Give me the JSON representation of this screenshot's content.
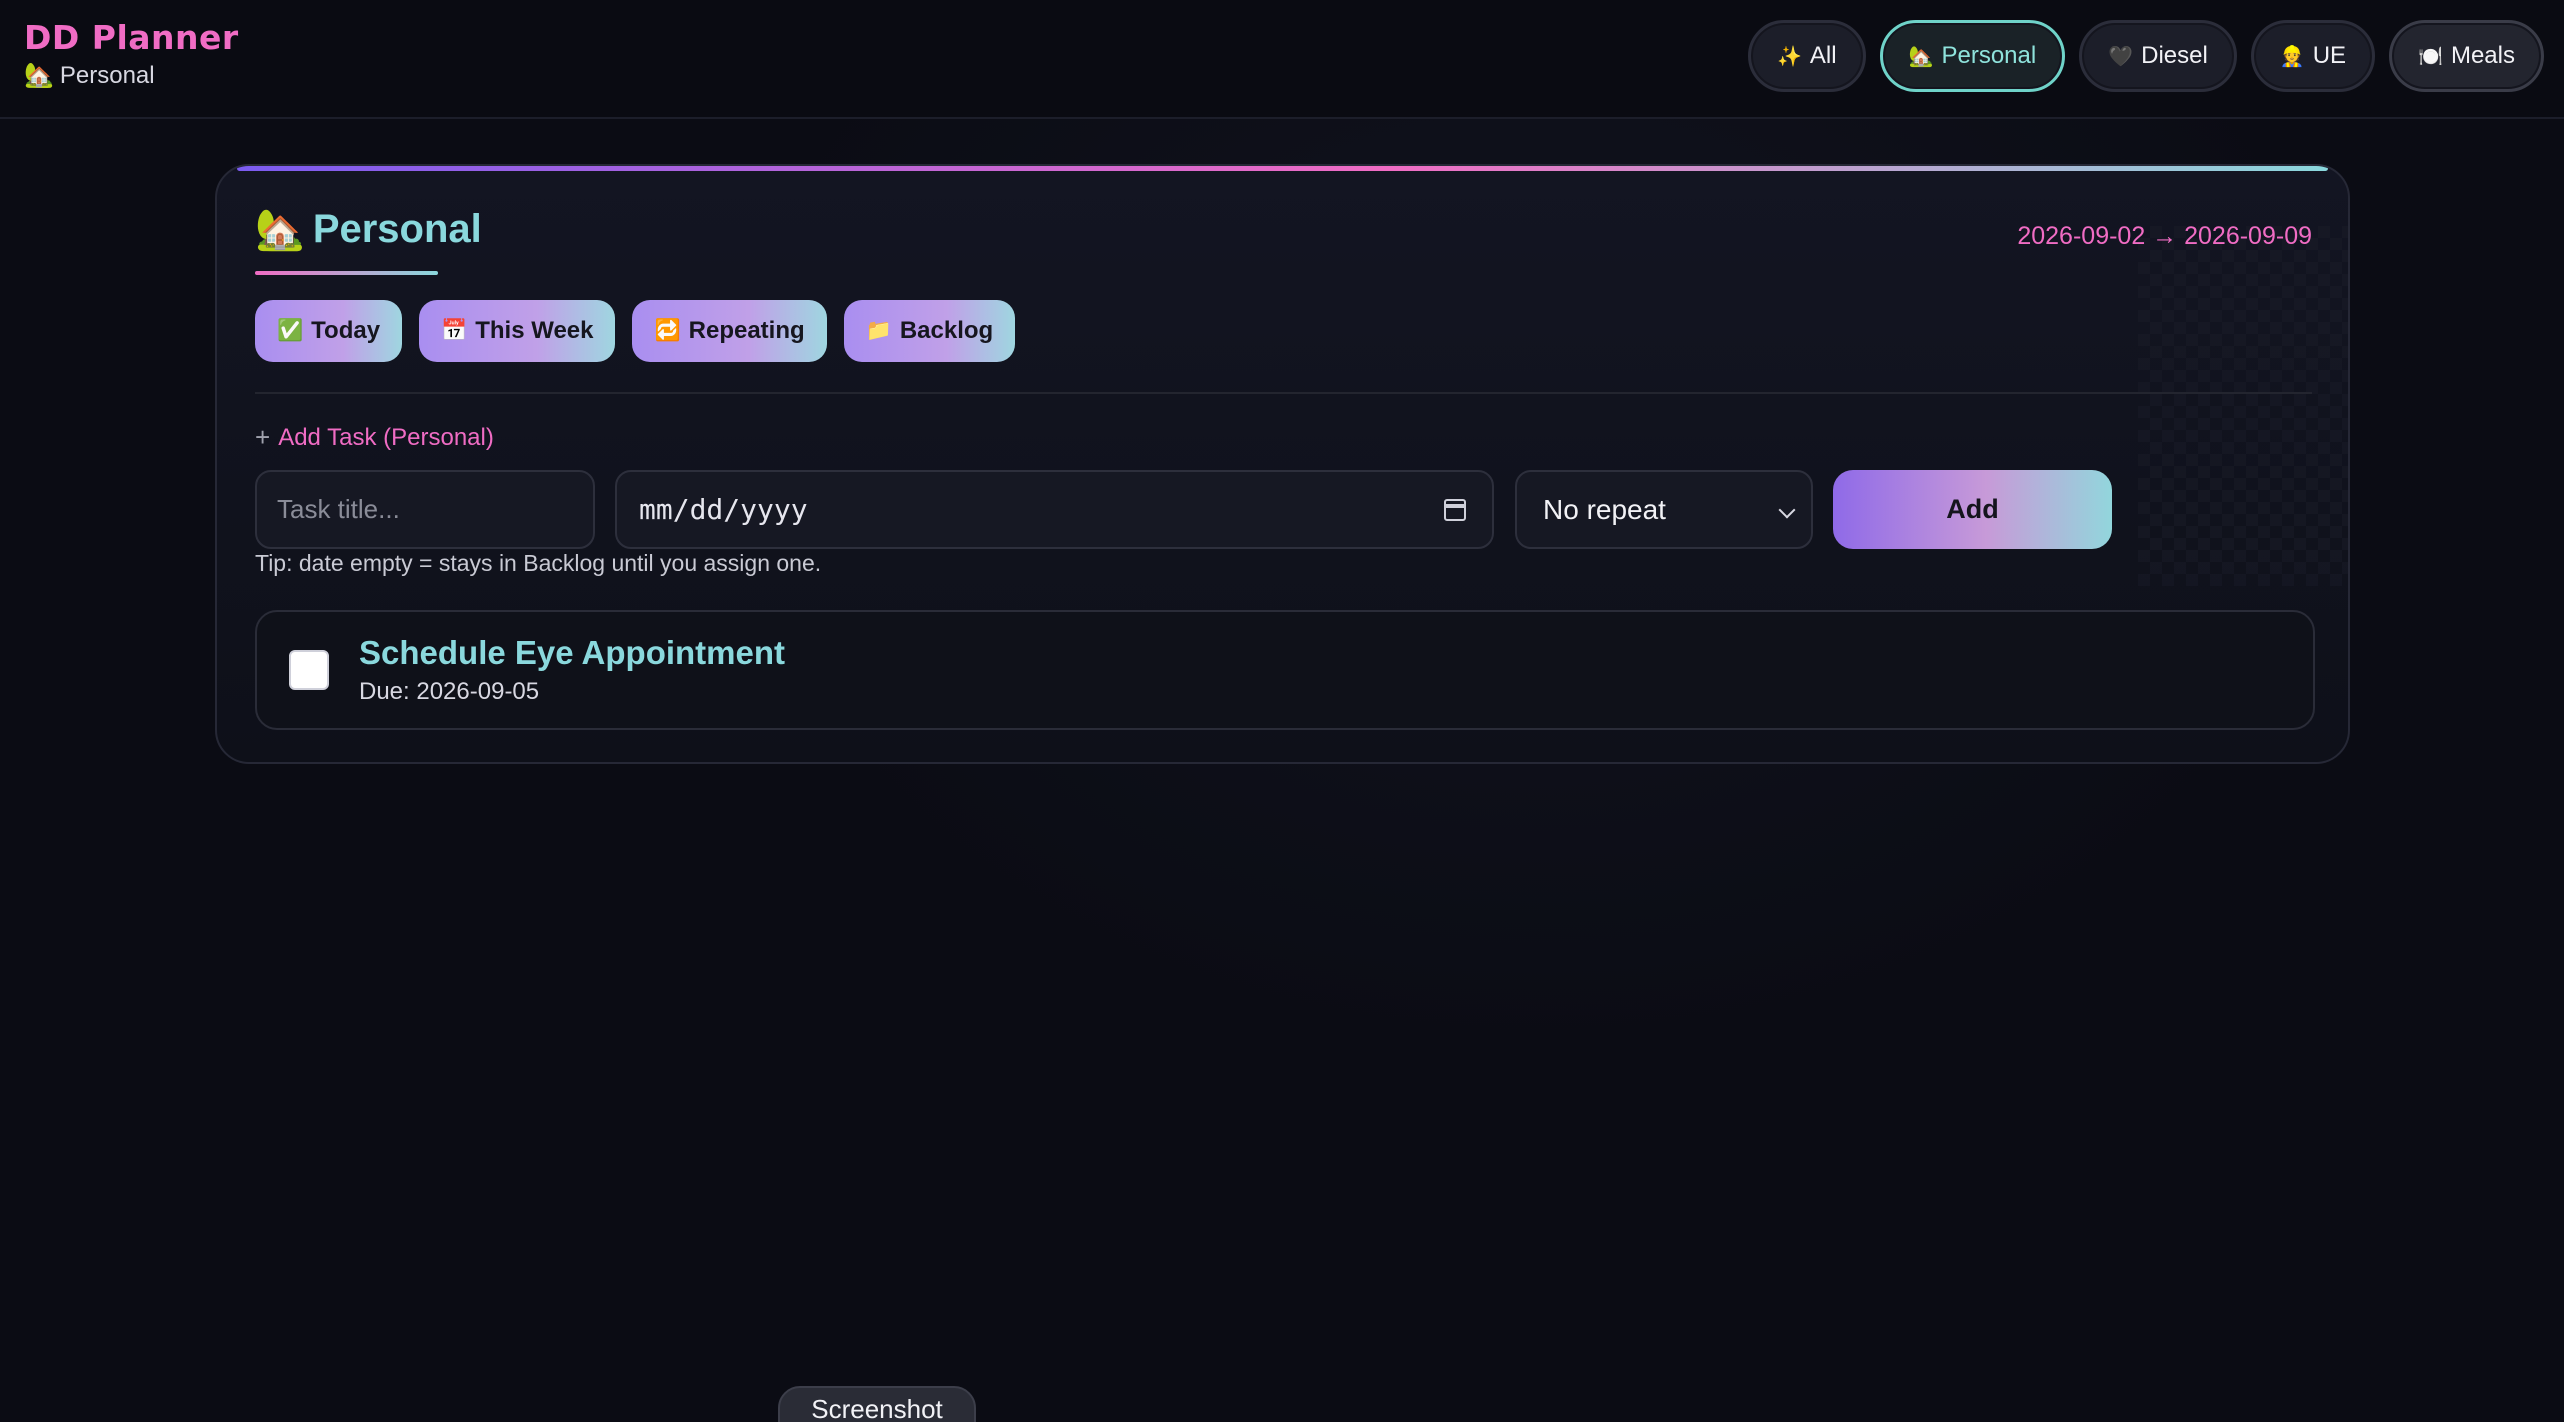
{
  "app": {
    "title": "DD Planner",
    "current_context": "Personal",
    "current_context_emoji": "🏡"
  },
  "nav": [
    {
      "emoji": "✨",
      "label": "All",
      "active": false
    },
    {
      "emoji": "🏡",
      "label": "Personal",
      "active": true
    },
    {
      "emoji": "🖤",
      "label": "Diesel",
      "active": false
    },
    {
      "emoji": "👷",
      "label": "UE",
      "active": false
    },
    {
      "emoji": "🍽️",
      "label": "Meals",
      "active": false
    }
  ],
  "card": {
    "title_emoji": "🏡",
    "title": "Personal",
    "date_range": "2026-09-02 → 2026-09-09",
    "tabs": [
      {
        "emoji": "✅",
        "label": "Today"
      },
      {
        "emoji": "📅",
        "label": "This Week"
      },
      {
        "emoji": "🔁",
        "label": "Repeating"
      },
      {
        "emoji": "📁",
        "label": "Backlog"
      }
    ],
    "add_task": {
      "label": "Add Task (Personal)",
      "plus": "+",
      "title_placeholder": "Task title...",
      "date_placeholder": "mm/dd/yyyy",
      "repeat_value": "No repeat",
      "button": "Add",
      "tip": "Tip: date empty = stays in Backlog until you assign one."
    },
    "tasks": [
      {
        "title": "Schedule Eye Appointment",
        "due": "Due: 2026-09-05",
        "done": false
      }
    ]
  },
  "overlay": {
    "screenshot_label": "Screenshot"
  },
  "colors": {
    "accent_pink": "#f06cc4",
    "accent_teal": "#8ad8dd",
    "accent_purple": "#8f6ae8",
    "background": "#0b0c14"
  }
}
